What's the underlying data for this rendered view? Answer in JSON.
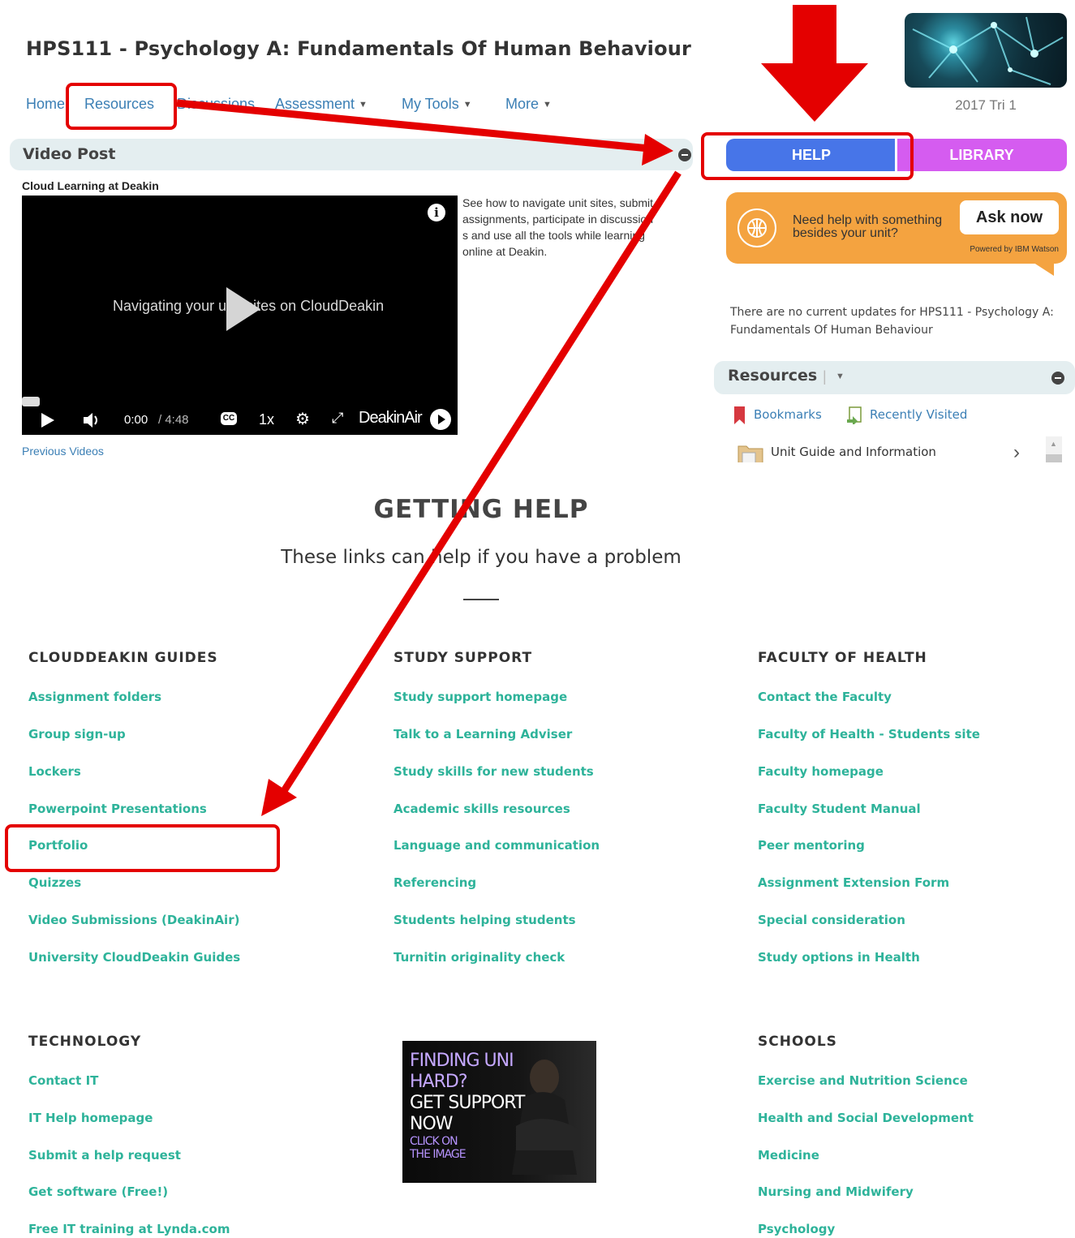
{
  "course": {
    "title": "HPS111 - Psychology A: Fundamentals Of Human Behaviour",
    "term": "2017 Tri 1"
  },
  "nav": {
    "home": "Home",
    "resources": "Resources",
    "discussions": "Discussions",
    "assessment": "Assessment",
    "my_tools": "My Tools",
    "more": "More"
  },
  "video_post": {
    "title": "Video Post",
    "subtitle": "Cloud Learning at Deakin",
    "player_caption": "Navigating your unit sites on CloudDeakin",
    "time_current": "0:00",
    "time_total": "/ 4:48",
    "speed": "1x",
    "brand": "DeakinAir",
    "description": "See how to navigate unit sites, submit assignments, participate in discussions and use all the tools while learning online at Deakin.",
    "previous_link": "Previous Videos"
  },
  "sidebar": {
    "help": "HELP",
    "library": "LIBRARY",
    "watson": {
      "prompt": "Need help with something besides your unit?",
      "button": "Ask now",
      "powered": "Powered by IBM Watson"
    },
    "updates": "There are no current updates for HPS111 - Psychology A: Fundamentals Of Human Behaviour",
    "resources": {
      "title": "Resources",
      "bookmarks": "Bookmarks",
      "recently_visited": "Recently Visited",
      "item": "Unit Guide and Information"
    }
  },
  "getting_help": {
    "title": "GETTING HELP",
    "subtitle": "These links can help if you have a problem",
    "columns": [
      {
        "heading": "CLOUDDEAKIN GUIDES",
        "links": [
          "Assignment folders",
          "Group sign-up",
          "Lockers",
          "Powerpoint Presentations",
          "Portfolio",
          "Quizzes",
          "Video Submissions (DeakinAir)",
          "University CloudDeakin Guides"
        ]
      },
      {
        "heading": "STUDY SUPPORT",
        "links": [
          "Study support homepage",
          "Talk to a Learning Adviser",
          "Study skills for new students",
          "Academic skills resources",
          "Language and communication",
          "Referencing",
          "Students helping students",
          "Turnitin originality check"
        ]
      },
      {
        "heading": "FACULTY OF HEALTH",
        "links": [
          "Contact the Faculty",
          "Faculty of Health - Students site",
          "Faculty homepage",
          "Faculty Student Manual",
          "Peer mentoring",
          "Assignment Extension Form",
          "Special consideration",
          "Study options in Health"
        ]
      },
      {
        "heading": "TECHNOLOGY",
        "links": [
          "Contact IT",
          "IT Help homepage",
          "Submit a help request",
          "Get software (Free!)",
          "Free IT training at Lynda.com"
        ]
      },
      {
        "heading": "SCHOOLS",
        "links": [
          "Exercise and Nutrition Science",
          "Health and Social Development",
          "Medicine",
          "Nursing and Midwifery",
          "Psychology"
        ]
      }
    ],
    "ad": {
      "line1": "FINDING UNI",
      "line2": "HARD?",
      "line3": "GET SUPPORT",
      "line4": "NOW",
      "line5": "CLICK ON",
      "line6": "THE IMAGE"
    }
  },
  "colors": {
    "link": "#2eb39a",
    "nav": "#3b7fb5",
    "help": "#4775e8",
    "library": "#d55cf0",
    "watson": "#f4a340",
    "annotation": "#e40000"
  }
}
